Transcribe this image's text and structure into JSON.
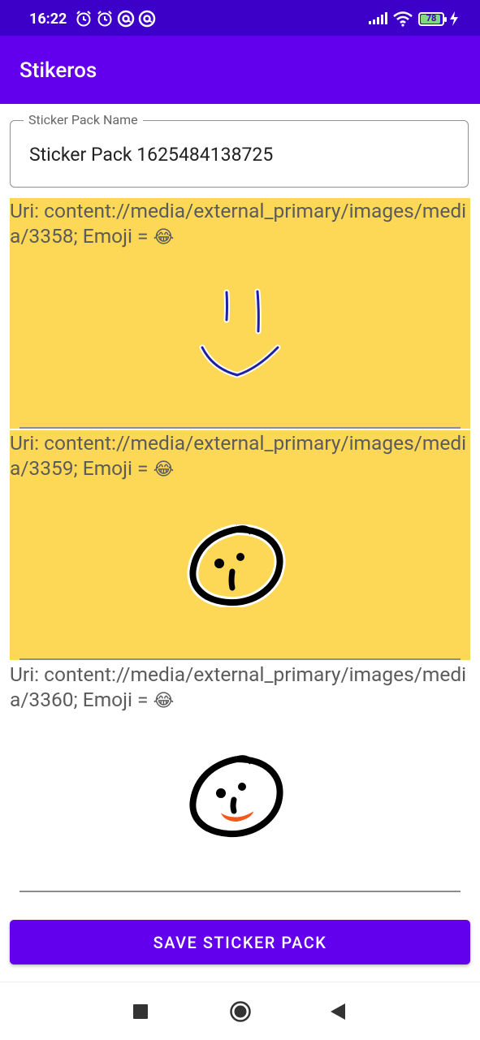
{
  "status_bar": {
    "time": "16:22",
    "battery": "78",
    "left_icons": [
      "alarm-icon",
      "alarm-clock-icon",
      "circle-at-icon",
      "circle-at-icon"
    ],
    "right_icons": [
      "signal-icon",
      "wifi-icon",
      "battery-icon",
      "charging-bolt-icon"
    ]
  },
  "app_bar": {
    "title": "Stikeros",
    "color": "#6200ee"
  },
  "pack_name": {
    "label": "Sticker Pack Name",
    "value": "Sticker Pack 1625484138725"
  },
  "stickers": [
    {
      "uri": "Uri: content://media/external_primary/images/media/3358; Emoji = ",
      "emoji": "😂",
      "image": "smiley-line-drawing",
      "selected": true
    },
    {
      "uri": "Uri: content://media/external_primary/images/media/3359; Emoji = ",
      "emoji": "😂",
      "image": "surprised-face-drawing",
      "selected": true
    },
    {
      "uri": "Uri: content://media/external_primary/images/media/3360; Emoji = ",
      "emoji": "😂",
      "image": "tongue-face-drawing",
      "selected": false
    }
  ],
  "save_button": {
    "label": "SAVE STICKER PACK"
  },
  "nav_bar": {
    "buttons": [
      "recents-square-icon",
      "home-circle-icon",
      "back-triangle-icon"
    ]
  },
  "colors": {
    "status_bar": "#3d00c9",
    "accent": "#6200ee",
    "selected_bg": "#fdd756"
  }
}
